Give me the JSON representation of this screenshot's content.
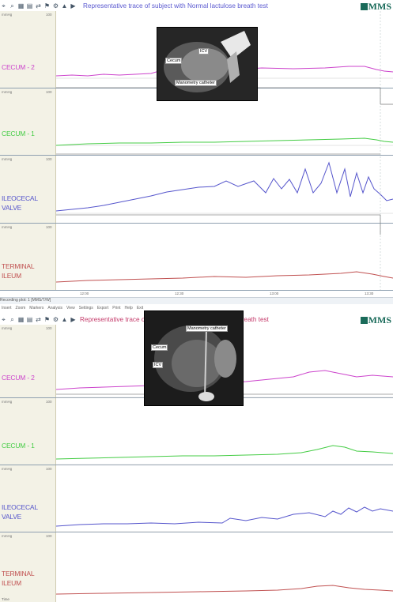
{
  "top": {
    "title": "Representative trace of subject with Normal lactulose breath test",
    "title_color": "#5b5ad0",
    "logo": "MMS",
    "channels": [
      {
        "label": "CECUM - 2",
        "color": "#cc44cc",
        "unit": "mmHg",
        "scale": "100"
      },
      {
        "label": "CECUM - 1",
        "color": "#44cc44",
        "unit": "mmHg",
        "scale": "100"
      },
      {
        "label": "ILEOCECAL VALVE",
        "color": "#5555cc",
        "unit": "mmHg",
        "scale": "100"
      },
      {
        "label": "TERMINAL ILEUM",
        "color": "#c05050",
        "unit": "mmHg",
        "scale": "100"
      }
    ],
    "photo_labels": {
      "icv": "ICV",
      "cecum": "Cecum",
      "catheter": "Manometry catheter"
    },
    "time_ticks": [
      "12:00",
      "12:30",
      "13:00",
      "13:30"
    ],
    "status": "Recording plot: 1 [MMS/T/W]"
  },
  "bottom": {
    "title": "Representative trace of subject with Positive Lactulose breath test",
    "title_color": "#c43a6a",
    "logo": "MMS",
    "menu": [
      "Insert",
      "Zoom",
      "Markers",
      "Analysis",
      "View",
      "Settings",
      "Export",
      "Print",
      "Help",
      "Exit"
    ],
    "channels": [
      {
        "label": "CECUM - 2",
        "color": "#cc44cc",
        "unit": "mmHg",
        "scale": "100"
      },
      {
        "label": "CECUM - 1",
        "color": "#44cc44",
        "unit": "mmHg",
        "scale": "100"
      },
      {
        "label": "ILEOCECAL VALVE",
        "color": "#5555cc",
        "unit": "mmHg",
        "scale": "100"
      },
      {
        "label": "TERMINAL ILEUM",
        "color": "#c05050",
        "unit": "mmHg",
        "scale": "100"
      }
    ],
    "photo_labels": {
      "icv": "ICV",
      "cecum": "Cecum",
      "catheter": "Manometry catheter"
    },
    "timestamp": "Time"
  }
}
